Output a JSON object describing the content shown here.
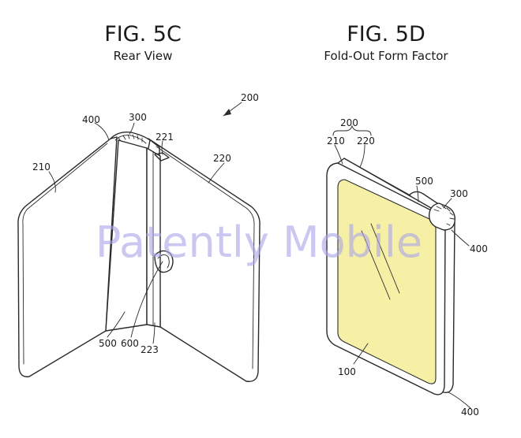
{
  "figures": [
    {
      "title": "FIG. 5C",
      "subtitle": "Rear View",
      "refs": {
        "r200": "200",
        "r400": "400",
        "r300": "300",
        "r221": "221",
        "r220": "220",
        "r210": "210",
        "r500": "500",
        "r600": "600",
        "r223": "223"
      }
    },
    {
      "title": "FIG. 5D",
      "subtitle": "Fold-Out Form Factor",
      "refs": {
        "r200": "200",
        "r210": "210",
        "r220": "220",
        "r500": "500",
        "r300": "300",
        "r400": "400",
        "r100": "100",
        "r400b": "400"
      }
    }
  ],
  "watermark": "Patently Mobile",
  "colors": {
    "screen_fill": "#f6f0a6",
    "watermark": "#a9a6e6",
    "line": "#2a2a2a"
  }
}
